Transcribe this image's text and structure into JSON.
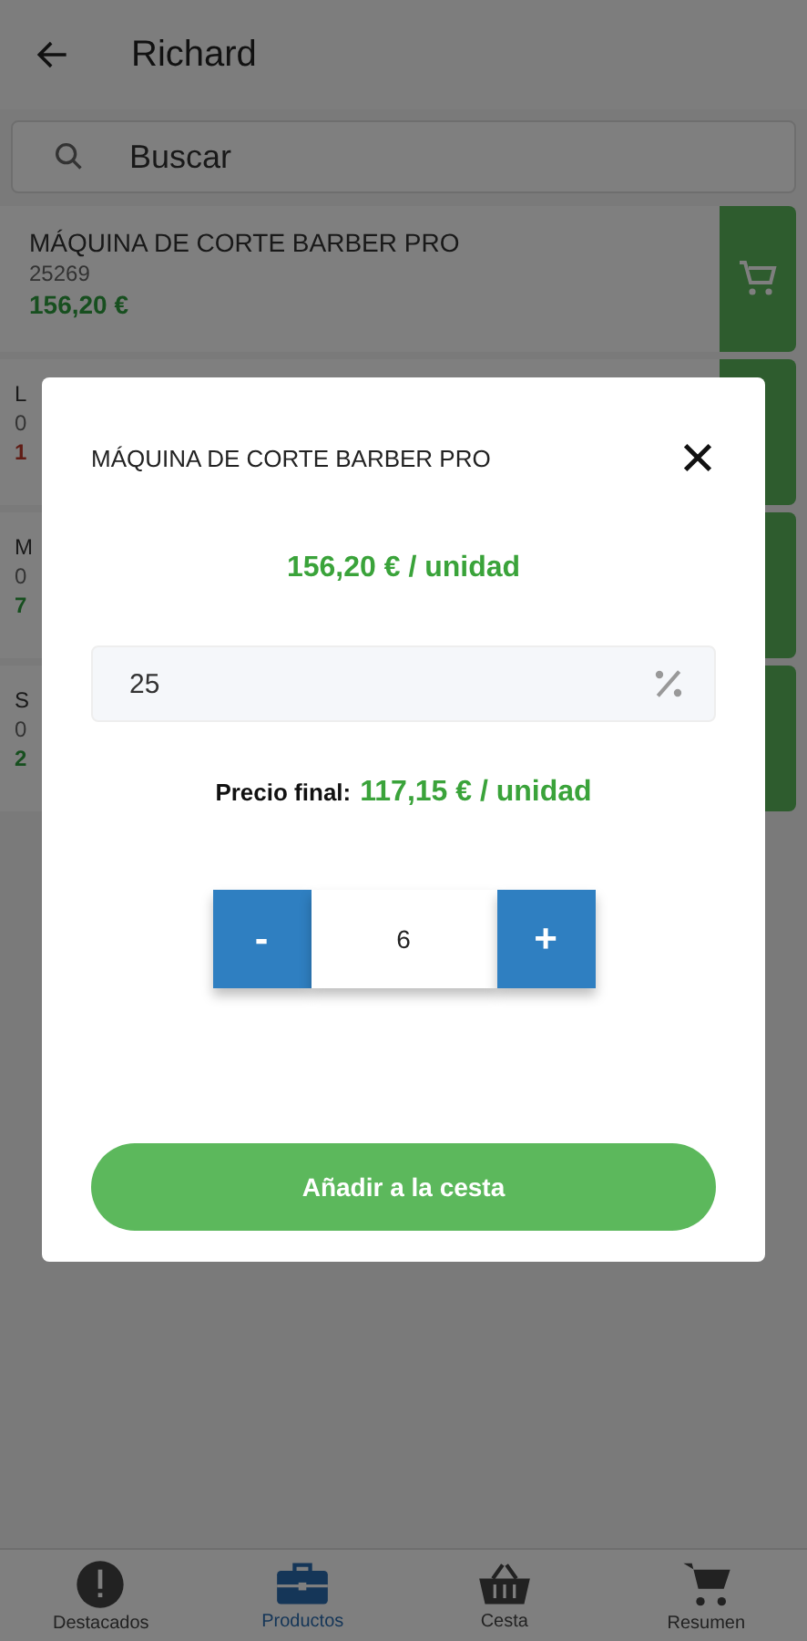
{
  "header": {
    "title": "Richard"
  },
  "search": {
    "placeholder": "Buscar"
  },
  "products": [
    {
      "name": "MÁQUINA DE CORTE BARBER PRO",
      "code": "25269",
      "price": "156,20 €",
      "kind": "normal"
    },
    {
      "name": "L",
      "code": "0",
      "price": "1",
      "kind": "warning"
    },
    {
      "name": "M",
      "code": "0",
      "price": "7",
      "kind": "normal"
    },
    {
      "name": "S",
      "code": "0",
      "price": "2",
      "kind": "normal"
    }
  ],
  "dialog": {
    "title": "MÁQUINA DE CORTE BARBER PRO",
    "unit_price": "156,20 € / unidad",
    "discount": "25",
    "final_label": "Precio final:",
    "final_price": "117,15 € / unidad",
    "minus": "-",
    "quantity": "6",
    "plus": "+",
    "add_button": "Añadir a la cesta"
  },
  "nav": [
    {
      "label": "Destacados",
      "selected": false
    },
    {
      "label": "Productos",
      "selected": true
    },
    {
      "label": "Cesta",
      "selected": false
    },
    {
      "label": "Resumen",
      "selected": false
    }
  ]
}
